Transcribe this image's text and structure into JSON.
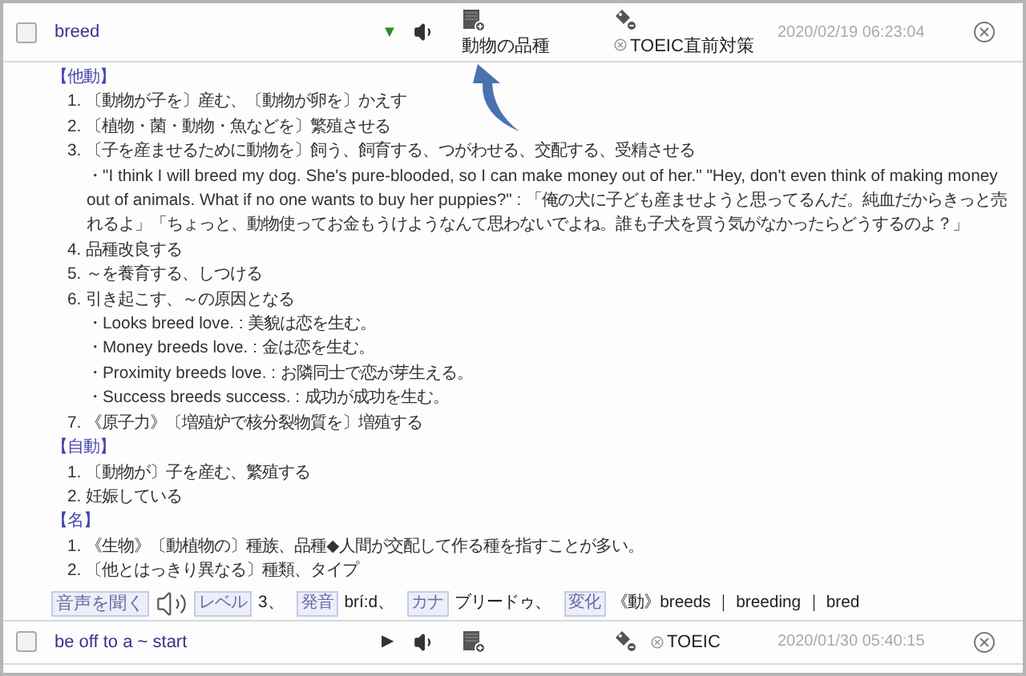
{
  "entries": [
    {
      "word": "breed",
      "checked": false,
      "expanded": true,
      "toggle": "▼",
      "memo": "動物の品種",
      "tag": "TOEIC直前対策",
      "date": "2020/02/19 06:23:04",
      "sections": [
        {
          "label": "【他動】",
          "items": [
            {
              "num": "1.",
              "text": "〔動物が子を〕産む、〔動物が卵を〕かえす"
            },
            {
              "num": "2.",
              "text": "〔植物・菌・動物・魚などを〕繁殖させる"
            },
            {
              "num": "3.",
              "text": "〔子を産ませるために動物を〕飼う、飼育する、つがわせる、交配する、受精させる",
              "examples": [
                "・\"I think I will breed my dog. She's pure-blooded, so I can make money out of her.\" \"Hey, don't even think of making money out of animals. What if no one wants to buy her puppies?\" : 「俺の犬に子ども産ませようと思ってるんだ。純血だからきっと売れるよ」「ちょっと、動物使ってお金もうけようなんて思わないでよね。誰も子犬を買う気がなかったらどうするのよ？」"
              ]
            },
            {
              "num": "4.",
              "text": "品種改良する"
            },
            {
              "num": "5.",
              "text": "～を養育する、しつける"
            },
            {
              "num": "6.",
              "text": "引き起こす、～の原因となる",
              "examples": [
                "・Looks breed love. : 美貌は恋を生む。",
                "・Money breeds love. : 金は恋を生む。",
                "・Proximity breeds love. : お隣同士で恋が芽生える。",
                "・Success breeds success. : 成功が成功を生む。"
              ]
            },
            {
              "num": "7.",
              "text": "《原子力》〔増殖炉で核分裂物質を〕増殖する"
            }
          ]
        },
        {
          "label": "【自動】",
          "items": [
            {
              "num": "1.",
              "text": "〔動物が〕子を産む、繁殖する"
            },
            {
              "num": "2.",
              "text": "妊娠している"
            }
          ]
        },
        {
          "label": "【名】",
          "items": [
            {
              "num": "1.",
              "text": "《生物》〔動植物の〕種族、品種◆人間が交配して作る種を指すことが多い。"
            },
            {
              "num": "2.",
              "text": "〔他とはっきり異なる〕種類、タイプ"
            }
          ]
        }
      ],
      "listen": "音声を聞く",
      "info": [
        {
          "label": "レベル",
          "value": "3、"
        },
        {
          "label": "発音",
          "value": "brí:d、"
        },
        {
          "label": "カナ",
          "value": "ブリードゥ、"
        },
        {
          "label": "変化",
          "value": "《動》breeds ｜ breeding ｜ bred"
        }
      ]
    },
    {
      "word": "be off to a ~ start",
      "checked": false,
      "expanded": false,
      "toggle": "▶",
      "tag": "TOEIC",
      "date": "2020/01/30 05:40:15"
    }
  ]
}
